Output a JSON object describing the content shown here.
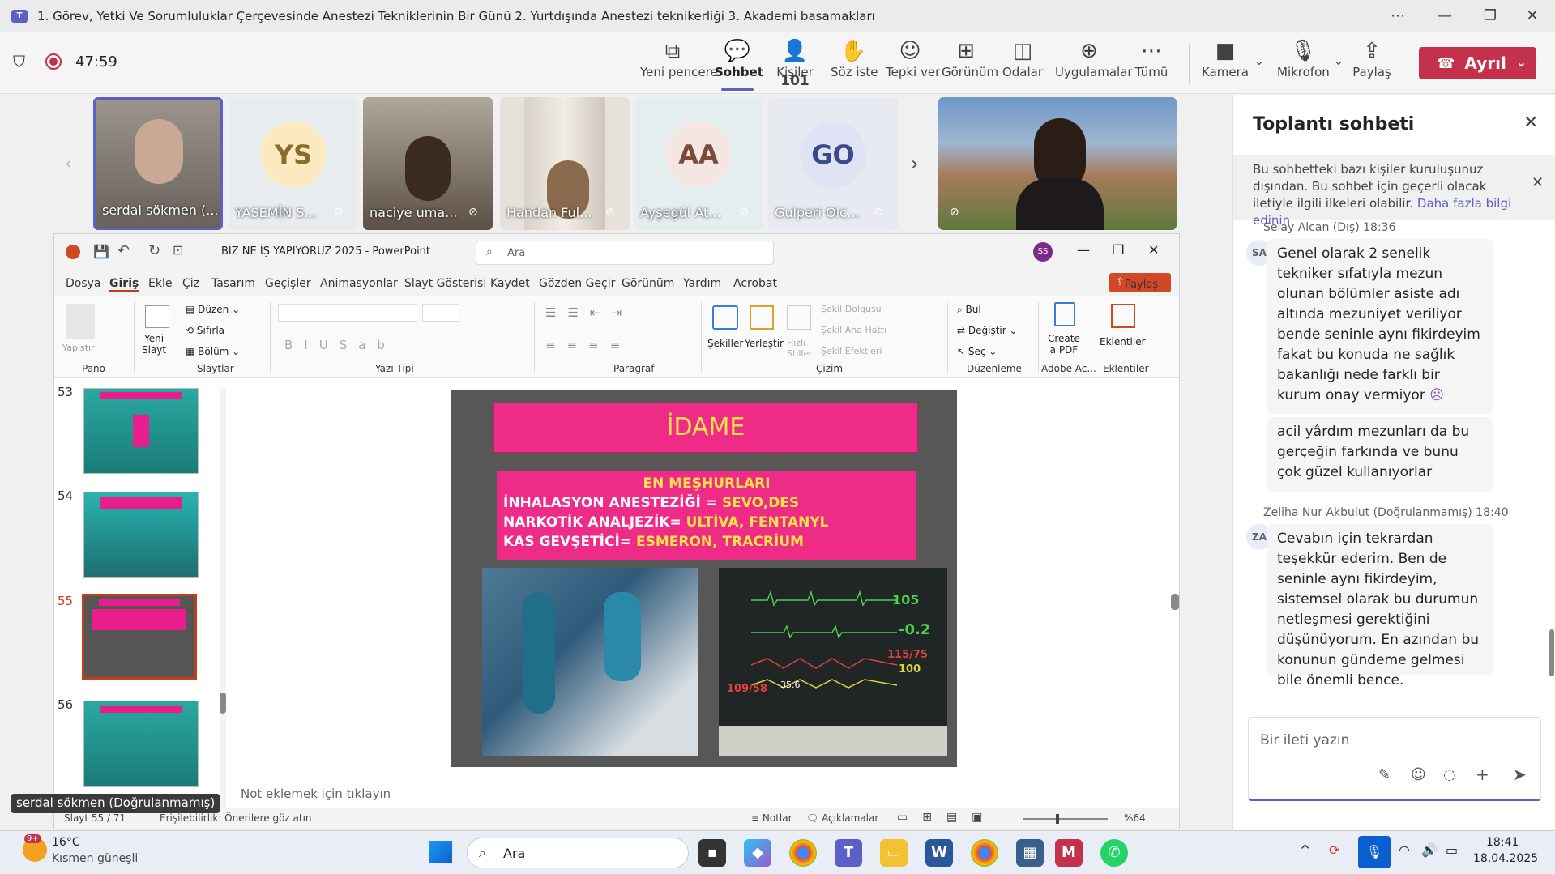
{
  "window": {
    "title": "1. Görev, Yetki Ve Sorumluluklar Çerçevesinde Anestezi Tekniklerinin Bir Günü 2. Yurtdışında Anestezi teknikerliği 3. Akademi basamakları",
    "logo": "T"
  },
  "meeting": {
    "timer": "47:59"
  },
  "toolbar": {
    "new_window": "Yeni pencere",
    "chat": "Sohbet",
    "people_count": "101",
    "people": "Kişiler",
    "raise_hand": "Söz iste",
    "react": "Tepki ver",
    "view": "Görünüm",
    "rooms": "Odalar",
    "apps": "Uygulamalar",
    "more": "Tümü",
    "camera": "Kamera",
    "mic": "Mikrofon",
    "share": "Paylaş",
    "leave": "Ayrıl"
  },
  "participants": [
    {
      "name": "serdal sökmen (..."
    },
    {
      "initials": "YS",
      "name": "YASEMİN S..."
    },
    {
      "name": "naciye uma..."
    },
    {
      "name": "Handan Ful..."
    },
    {
      "initials": "AA",
      "name": "Ayşegül At..."
    },
    {
      "initials": "GO",
      "name": "Gulperi Olc..."
    }
  ],
  "speaker_label": "serdal sökmen (Doğrulanmamış)",
  "ppt": {
    "title": "BİZ NE İŞ YAPIYORUZ 2025 - PowerPoint",
    "search": "Ara",
    "user": "SS",
    "tabs": [
      "Dosya",
      "Giriş",
      "Ekle",
      "Çiz",
      "Tasarım",
      "Geçişler",
      "Animasyonlar",
      "Slayt Gösterisi",
      "Kaydet",
      "Gözden Geçir",
      "Görünüm",
      "Yardım",
      "Acrobat"
    ],
    "share": "Paylaş",
    "groups": {
      "pano": "Pano",
      "slaytlar": "Slaytlar",
      "yazi": "Yazı Tipi",
      "paragraf": "Paragraf",
      "cizim": "Çizim",
      "duzen": "Düzenleme",
      "adobe": "Adobe Ac...",
      "eklenti": "Eklentiler"
    },
    "buttons": {
      "yapistir": "Yapıştır",
      "yeni_slayt": "Yeni\nSlayt",
      "duzen": "Düzen",
      "sifirla": "Sıfırla",
      "bolum": "Bölüm",
      "sekiller": "Şekiller",
      "yerlestir": "Yerleştir",
      "hizli": "Hızlı\nStiller",
      "dolgu": "Şekil Dolgusu",
      "anahat": "Şekil Ana Hattı",
      "efekt": "Şekil Efektleri",
      "bul": "Bul",
      "degistir": "Değiştir",
      "sec": "Seç",
      "pdf": "Create\na PDF",
      "eklentiler": "Eklentiler"
    },
    "thumbs": [
      "53",
      "54",
      "55",
      "56"
    ],
    "slide": {
      "title": "İDAME",
      "heading": "EN MEŞHURLARI",
      "l1a": "İNHALASYON ANESTEZİĞİ = ",
      "l1b": "SEVO,DES",
      "l2a": "NARKOTİK ANALJEZİK= ",
      "l2b": "ULTİVA, FENTANYL",
      "l3a": "KAS GEVŞETİCİ= ",
      "l3b": "ESMERON, TRACRİUM",
      "monitor": [
        "105",
        "-0.2",
        "115/75",
        "100",
        "109/58",
        "35.6"
      ]
    },
    "notes": "Not eklemek için tıklayın",
    "status": {
      "slide": "Slayt 55 / 71",
      "access": "Erişilebilirlik: Önerilere göz atın",
      "notes": "Notlar",
      "comments": "Açıklamalar",
      "zoom": "%64"
    }
  },
  "chat": {
    "title": "Toplantı sohbeti",
    "banner": "Bu sohbetteki bazı kişiler kuruluşunuz dışından. Bu sohbet için geçerli olacak iletiyle ilgili ilkeleri olabilir.",
    "banner_link": "Daha fazla bilgi edinin",
    "m1_sender": "Selay Alcan (Dış)",
    "m1_time": "18:36",
    "m1_av": "SA",
    "m1_text": "Genel olarak 2 senelik tekniker sıfatıyla mezun olunan bölümler asiste adı altında mezuniyet veriliyor bende seninle aynı fikirdeyim fakat bu konuda ne sağlık bakanlığı nede farklı bir kurum onay vermiyor",
    "m2_text": "acil yârdım mezunları da bu gerçeğin farkında ve bunu çok güzel kullanıyorlar",
    "m3_sender": "Zeliha Nur Akbulut (Doğrulanmamış)",
    "m3_time": "18:40",
    "m3_av": "ZA",
    "m3_text": "Cevabın için tekrardan teşekkür ederim. Ben de seninle aynı fikirdeyim, sistemsel olarak bu durumun netleşmesi gerektiğini düşünüyorum. En azından bu konunun gündeme gelmesi bile önemli bence.",
    "placeholder": "Bir ileti yazın"
  },
  "taskbar": {
    "temp": "16°C",
    "weather": "Kısmen güneşli",
    "badge": "9+",
    "search": "Ara",
    "time": "18:41",
    "date": "18.04.2025"
  }
}
